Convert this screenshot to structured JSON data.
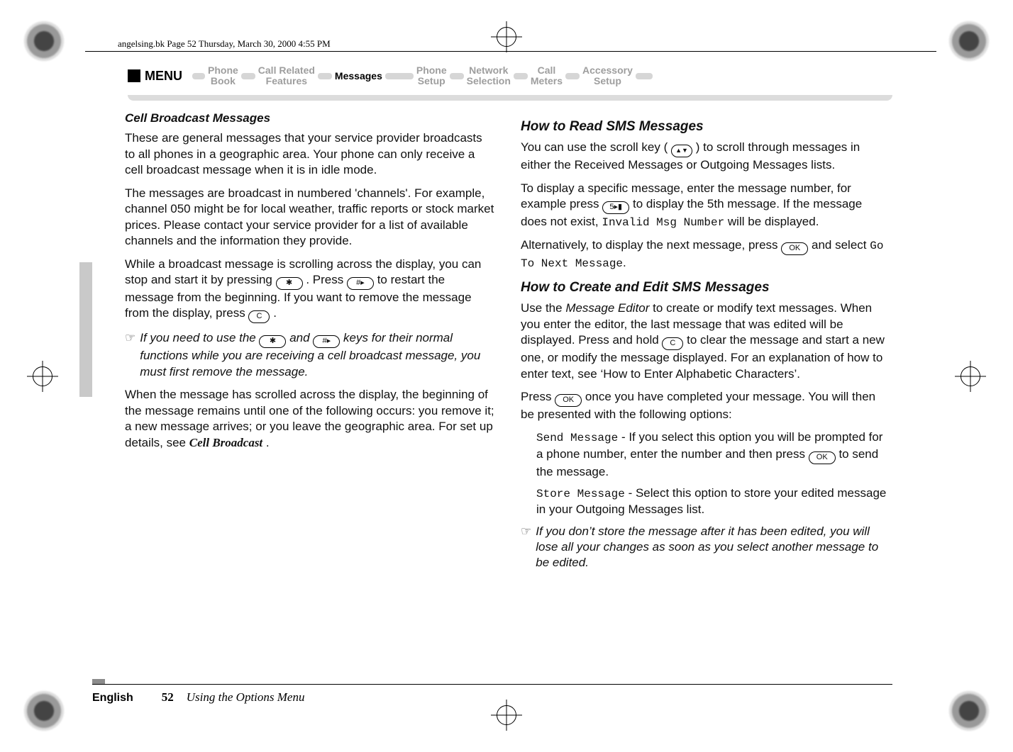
{
  "running_head": "angelsing.bk  Page 52  Thursday, March 30, 2000  4:55 PM",
  "menubar": {
    "menu_label": "MENU",
    "items": [
      {
        "line1": "Phone",
        "line2": "Book",
        "active": false
      },
      {
        "line1": "Call Related",
        "line2": "Features",
        "active": false
      },
      {
        "line1": "Messages",
        "line2": "",
        "active": true
      },
      {
        "line1": "Phone",
        "line2": "Setup",
        "active": false
      },
      {
        "line1": "Network",
        "line2": "Selection",
        "active": false
      },
      {
        "line1": "Call",
        "line2": "Meters",
        "active": false
      },
      {
        "line1": "Accessory",
        "line2": "Setup",
        "active": false
      }
    ]
  },
  "left": {
    "runin": "Cell Broadcast Messages",
    "p1": "These are general messages that your service provider broadcasts to all phones in a geographic area. Your phone can only receive a cell broadcast message when it is in idle mode.",
    "p2": "The messages are broadcast in numbered 'channels'. For example, channel 050 might be for local weather, traffic reports or stock market prices. Please contact your service provider for a list of available channels and the information they provide.",
    "p3a": "While a broadcast message is scrolling across the display, you can stop and start it by pressing ",
    "p3b": ". Press ",
    "p3c": " to restart the message from the beginning. If you want to remove the message from the display, press ",
    "p3d": ".",
    "note1a": "If you need to use the ",
    "note1b": " and ",
    "note1c": " keys for their normal functions while you are receiving a cell broadcast message, you must first remove the message.",
    "p4a": "When the message has scrolled across the display, the beginning of the message remains until one of the following occurs: you remove it; a new message arrives; or you leave the geographic area. For set up details, see ",
    "p4_crossref": "Cell Broadcast",
    "p4b": ".",
    "key_star": "✱",
    "key_hash": "#▸",
    "key_c": "C"
  },
  "right": {
    "h_read": "How to Read SMS Messages",
    "r1a": "You can use the scroll key (",
    "r1b": ") to scroll through messages in either the Received Messages or Outgoing Messages lists.",
    "r2a": "To display a specific message, enter the message number, for example press ",
    "r2b": " to display the 5th message. If the message does not exist, ",
    "r2_invalid": "Invalid Msg Number",
    "r2c": " will be displayed.",
    "r3a": "Alternatively, to display the next message, press ",
    "r3b": " and select ",
    "r3_goto": "Go To Next Message",
    "r3c": ".",
    "h_create": "How to Create and Edit SMS Messages",
    "c1a": "Use the ",
    "c1_editor": "Message Editor",
    "c1b": " to create or modify text messages. When you enter the editor, the last message that was edited will be displayed. Press and hold ",
    "c1c": " to clear the message and start a new one, or modify the message displayed. For an explanation of how to enter text, see ‘How to Enter Alphabetic Characters’.",
    "c2a": "Press ",
    "c2b": " once you have completed your message. You will then be presented with the following options:",
    "opt1_label": "Send Message",
    "opt1a": " - If you select this option you will be prompted for a phone number, enter the number and then press ",
    "opt1b": " to send the message.",
    "opt2_label": "Store Message",
    "opt2a": " - Select this option to store your edited message in your Outgoing Messages list.",
    "note2": "If you don’t store the message after it has been edited, you will lose all your changes as soon as you select another message to be edited.",
    "key_5": "5▸▮",
    "key_ok": "OK",
    "key_c": "C"
  },
  "footer": {
    "lang": "English",
    "page_number": "52",
    "section": "Using the Options Menu"
  },
  "note_hand_glyph": "☞"
}
